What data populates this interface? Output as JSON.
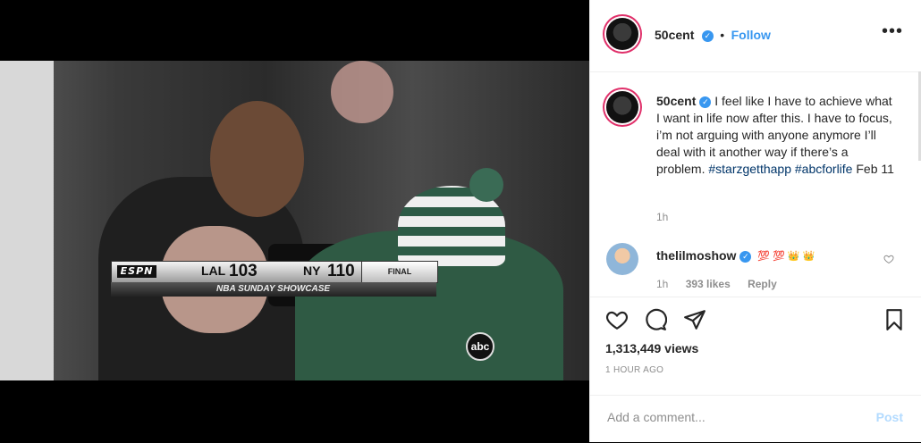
{
  "post": {
    "author": "50cent",
    "follow_label": "Follow",
    "more_label": "•••",
    "caption_text": "I feel like I have to achieve what I want in life now after this. I have to focus, i’m not arguing with anyone anymore I’ll deal with it another way if there’s a problem.",
    "hashtag_1": "#starzgetthapp",
    "hashtag_2": "#abcforlife",
    "caption_date": "Feb 11",
    "caption_age": "1h",
    "views": "1,313,449 views",
    "posted_ago": "1 HOUR AGO"
  },
  "reply": {
    "author": "thelilmoshow",
    "emojis": [
      "💯",
      "💯",
      "👑",
      "👑"
    ],
    "age": "1h",
    "likes": "393 likes",
    "reply_label": "Reply"
  },
  "add_comment": {
    "placeholder": "Add a comment...",
    "post_label": "Post"
  },
  "video": {
    "broadcaster": "ESPN",
    "team_left": "LAL",
    "score_left": "103",
    "team_right": "NY",
    "score_right": "110",
    "status": "FINAL",
    "program": "NBA SUNDAY SHOWCASE",
    "network": "abc"
  },
  "colors": {
    "accent": "#3897f0",
    "hashtag": "#003569",
    "muted": "#8e8e8e",
    "story_ring": "#e0306a"
  },
  "icons": [
    "heart-icon",
    "comment-icon",
    "share-icon",
    "bookmark-icon",
    "verified-icon",
    "more-icon"
  ]
}
